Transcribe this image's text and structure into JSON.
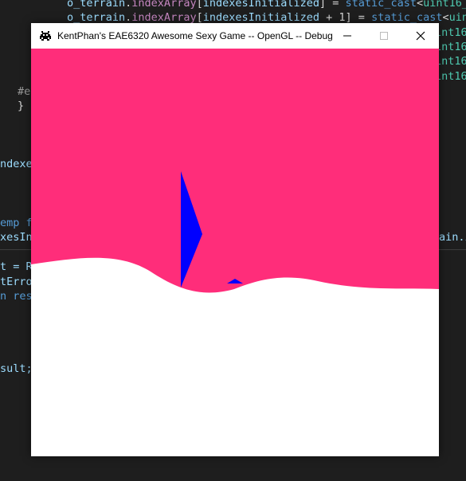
{
  "editor": {
    "lines": [
      {
        "segments": [
          {
            "t": "o_terrain",
            "c": "var"
          },
          {
            "t": ".",
            "c": "op"
          },
          {
            "t": "indexArray",
            "c": "fn"
          },
          {
            "t": "[",
            "c": "op"
          },
          {
            "t": "indexesInitialized",
            "c": "var"
          },
          {
            "t": "] = ",
            "c": "op"
          },
          {
            "t": "static_cast",
            "c": "kw"
          },
          {
            "t": "<",
            "c": "op"
          },
          {
            "t": "uint16_t",
            "c": "type"
          },
          {
            "t": ">(",
            "c": "op"
          }
        ]
      },
      {
        "segments": [
          {
            "t": "o_terrain",
            "c": "var"
          },
          {
            "t": ".",
            "c": "op"
          },
          {
            "t": "indexArray",
            "c": "fn"
          },
          {
            "t": "[",
            "c": "op"
          },
          {
            "t": "indexesInitialized",
            "c": "var"
          },
          {
            "t": " + 1] = ",
            "c": "op"
          },
          {
            "t": "static_cast",
            "c": "kw"
          },
          {
            "t": "<",
            "c": "op"
          },
          {
            "t": "uint16",
            "c": "type"
          }
        ]
      },
      {
        "segments": [
          {
            "t": "int16",
            "c": "type"
          }
        ]
      },
      {
        "segments": [
          {
            "t": "int16",
            "c": "type"
          }
        ]
      },
      {
        "segments": [
          {
            "t": "int16",
            "c": "type"
          }
        ]
      },
      {
        "segments": [
          {
            "t": "int16",
            "c": "type"
          }
        ]
      },
      {
        "segments": [
          {
            "t": "#e",
            "c": "pre"
          }
        ]
      },
      {
        "segments": [
          {
            "t": "}",
            "c": "op"
          }
        ]
      },
      {
        "segments": [
          {
            "t": "ndexe",
            "c": "var"
          }
        ]
      },
      {
        "segments": [
          {
            "t": "emp f",
            "c": "kw"
          }
        ]
      },
      {
        "segments": [
          {
            "t": "xesIn",
            "c": "var"
          }
        ]
      },
      {
        "segments": [
          {
            "t": "ain.i",
            "c": "var"
          }
        ]
      },
      {
        "segments": [
          {
            "t": "t = R",
            "c": "var"
          }
        ]
      },
      {
        "segments": [
          {
            "t": "tErro",
            "c": "var"
          }
        ]
      },
      {
        "segments": [
          {
            "t": "n res",
            "c": "kw"
          }
        ]
      },
      {
        "segments": [
          {
            "t": "sult;",
            "c": "var"
          }
        ]
      }
    ]
  },
  "window": {
    "title": "KentPhan's EAE6320 Awesome Sexy Game -- OpenGL -- Debug",
    "controls": {
      "minimize": "minimize-icon",
      "maximize": "maximize-icon",
      "close": "close-icon"
    },
    "app_icon": "space-invader-icon",
    "viewport": {
      "background_color": "#ff2d7a",
      "terrain_color": "#ffffff",
      "shape_color": "#0000ff"
    }
  }
}
